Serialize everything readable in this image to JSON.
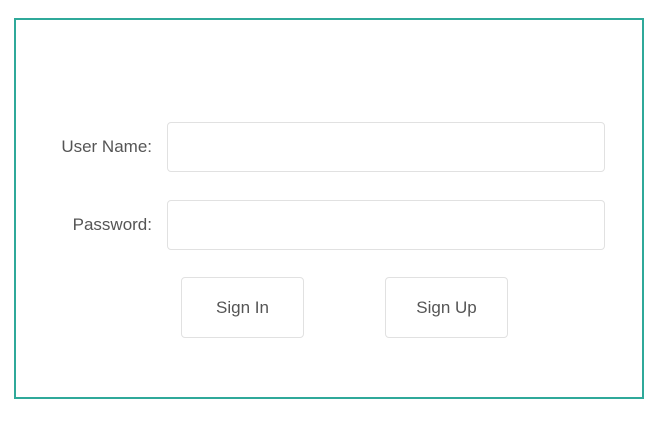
{
  "form": {
    "username_label": "User Name:",
    "username_value": "",
    "password_label": "Password:",
    "password_value": "",
    "signin_label": "Sign In",
    "signup_label": "Sign Up"
  },
  "colors": {
    "border_accent": "#2fa99a",
    "field_border": "#e1e1e1",
    "text": "#555555"
  }
}
